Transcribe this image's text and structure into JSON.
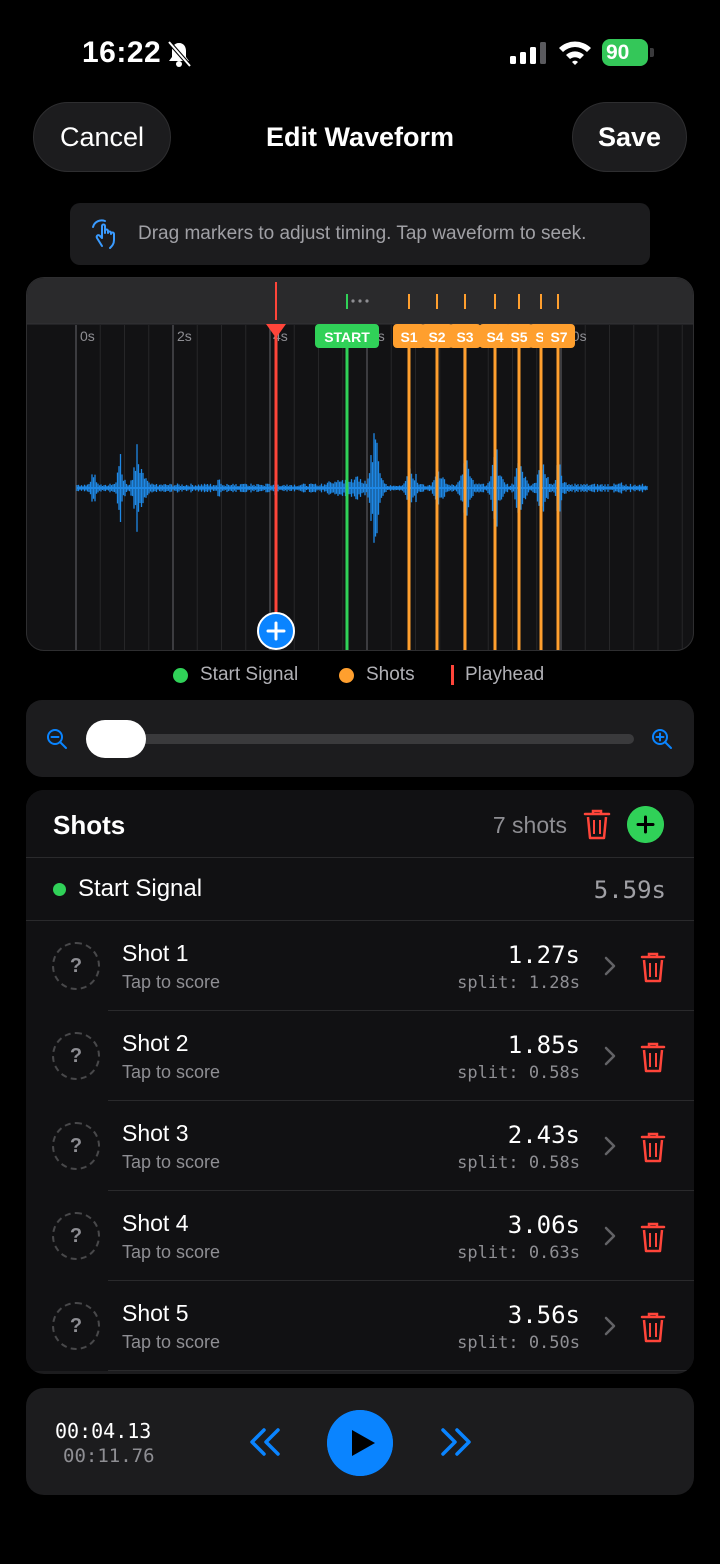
{
  "status_bar": {
    "time": "16:22",
    "battery": "90"
  },
  "nav": {
    "cancel": "Cancel",
    "title": "Edit Waveform",
    "save": "Save"
  },
  "hint": {
    "text": "Drag markers to adjust timing. Tap waveform to seek."
  },
  "waveform": {
    "time_labels": [
      "0s",
      "2s",
      "4s",
      "6s",
      "8s",
      "10s"
    ],
    "playhead_seconds": 4.13,
    "total_seconds": 11.76,
    "markers": [
      {
        "label": "START",
        "kind": "start"
      },
      {
        "label": "S1",
        "kind": "shot"
      },
      {
        "label": "S2",
        "kind": "shot"
      },
      {
        "label": "S3",
        "kind": "shot"
      },
      {
        "label": "S4",
        "kind": "shot"
      },
      {
        "label": "S5",
        "kind": "shot"
      },
      {
        "label": "S",
        "kind": "shot"
      },
      {
        "label": "S7",
        "kind": "shot"
      }
    ],
    "colors": {
      "waveform": "#1e88e5",
      "start": "#30d158",
      "shot": "#ff9f2e",
      "playhead": "#ff453a"
    }
  },
  "legend": {
    "start": "Start Signal",
    "shots": "Shots",
    "playhead": "Playhead"
  },
  "zoom": {
    "level": 0.0
  },
  "shots_panel": {
    "title": "Shots",
    "count": "7 shots",
    "start_label": "Start Signal",
    "start_time": "5.59s",
    "rows": [
      {
        "score": "?",
        "name": "Shot 1",
        "sub": "Tap to score",
        "time": "1.27s",
        "split": "split: 1.28s"
      },
      {
        "score": "?",
        "name": "Shot 2",
        "sub": "Tap to score",
        "time": "1.85s",
        "split": "split: 0.58s"
      },
      {
        "score": "?",
        "name": "Shot 3",
        "sub": "Tap to score",
        "time": "2.43s",
        "split": "split: 0.58s"
      },
      {
        "score": "?",
        "name": "Shot 4",
        "sub": "Tap to score",
        "time": "3.06s",
        "split": "split: 0.63s"
      },
      {
        "score": "?",
        "name": "Shot 5",
        "sub": "Tap to score",
        "time": "3.56s",
        "split": "split: 0.50s"
      }
    ]
  },
  "transport": {
    "current": "00:04.13",
    "total": "00:11.76"
  }
}
